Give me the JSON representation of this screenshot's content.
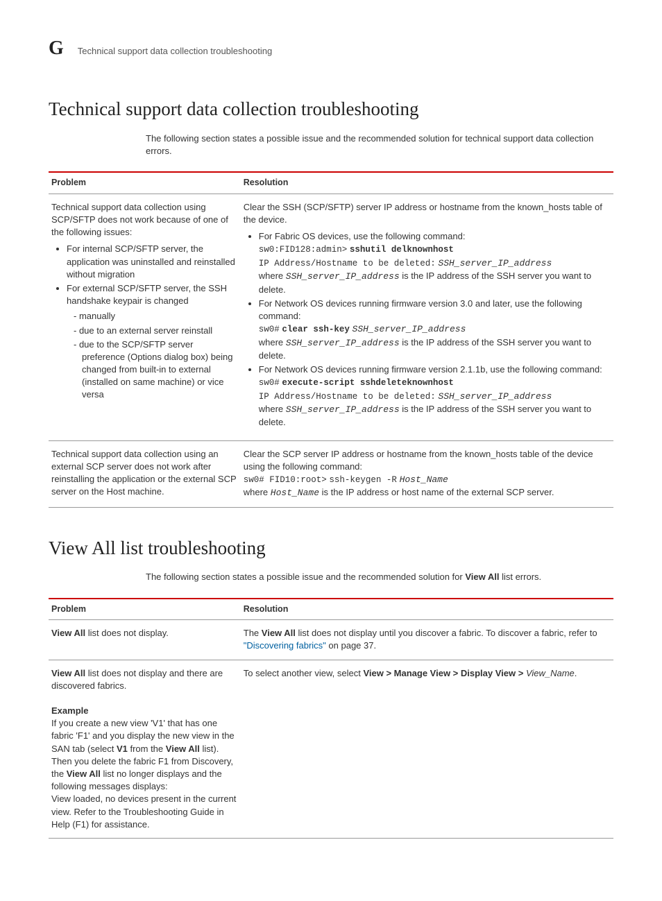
{
  "header": {
    "letter": "G",
    "title": "Technical support data collection troubleshooting"
  },
  "section1": {
    "heading": "Technical support data collection troubleshooting",
    "intro": "The following section states a possible issue and the recommended solution for technical support data collection errors.",
    "th_problem": "Problem",
    "th_resolution": "Resolution",
    "row1": {
      "problem_lead": "Technical support data collection using SCP/SFTP does not work because of one of the following issues:",
      "bullet1": "For internal SCP/SFTP server, the application was uninstalled and reinstalled without migration",
      "bullet2": "For external SCP/SFTP server, the SSH handshake keypair is changed",
      "inner1": "manually",
      "inner2": "due to an external server reinstall",
      "inner3": "due to the SCP/SFTP server preference (Options dialog box) being changed from built-in to external (installed on same machine) or vice versa",
      "res_lead": "Clear the SSH (SCP/SFTP) server IP address or hostname from the known_hosts table of the device.",
      "fabric_intro": "For Fabric OS devices, use the following command:",
      "fabric_prompt": "sw0:FID128:admin>",
      "fabric_cmd": "sshutil delknownhost",
      "fabric_ip_line_pre": "IP Address/Hostname to be deleted:",
      "ip_var": "SSH_server_IP_address",
      "where_pre": "where",
      "where_post": "is the IP address of the SSH server you want to delete.",
      "net30_intro": "For Network OS devices running firmware version 3.0 and later, use the following command:",
      "net30_prompt": "sw0#",
      "net30_cmd": "clear ssh-key",
      "net211_intro": "For Network OS devices running firmware version 2.1.1b, use the following command:",
      "net211_prompt": "sw0#",
      "net211_cmd": "execute-script sshdeleteknownhost",
      "net211_ip_line_pre": "IP Address/Hostname to be deleted:"
    },
    "row2": {
      "problem": "Technical support data collection using an external SCP server does not work after reinstalling the application or the external SCP server on the Host machine.",
      "res_lead": "Clear the SCP server IP address or hostname from the known_hosts table of the device using the following command:",
      "prompt": "sw0# FID10:root>",
      "cmd": "ssh-keygen -R",
      "host_var": "Host_Name",
      "where_pre": "where",
      "where_post": "is the IP address or host name of the external SCP server."
    }
  },
  "section2": {
    "heading": "View All list troubleshooting",
    "intro_pre": "The following section states a possible issue and the recommended solution for ",
    "intro_bold": "View All",
    "intro_post": " list errors.",
    "th_problem": "Problem",
    "th_resolution": "Resolution",
    "row1": {
      "prob_bold": "View All",
      "prob_post": " list does not display.",
      "res_pre": "The ",
      "res_bold": "View All",
      "res_mid": " list does not display until you discover a fabric. To discover a fabric, refer to ",
      "link": "\"Discovering fabrics\"",
      "res_post": " on page 37."
    },
    "row2": {
      "prob_bold": "View All",
      "prob_post": " list does not display and there are discovered fabrics.",
      "example_label": "Example",
      "ex_pre": "If you create a new view 'V1' that has one fabric 'F1' and you display the new view in the SAN tab (select ",
      "ex_b1": "V1",
      "ex_mid1": " from the ",
      "ex_b2": "View All",
      "ex_mid2": " list). Then you delete the fabric F1 from Discovery, the ",
      "ex_b3": "View All",
      "ex_post": " list no longer displays and the following messages displays:",
      "msg": "View loaded, no devices present in the current view. Refer to the Troubleshooting Guide in Help (F1) for assistance.",
      "res_pre": "To select another view, select ",
      "res_path": "View > Manage View > Display View > ",
      "res_var": "View_Name",
      "res_post": "."
    }
  }
}
